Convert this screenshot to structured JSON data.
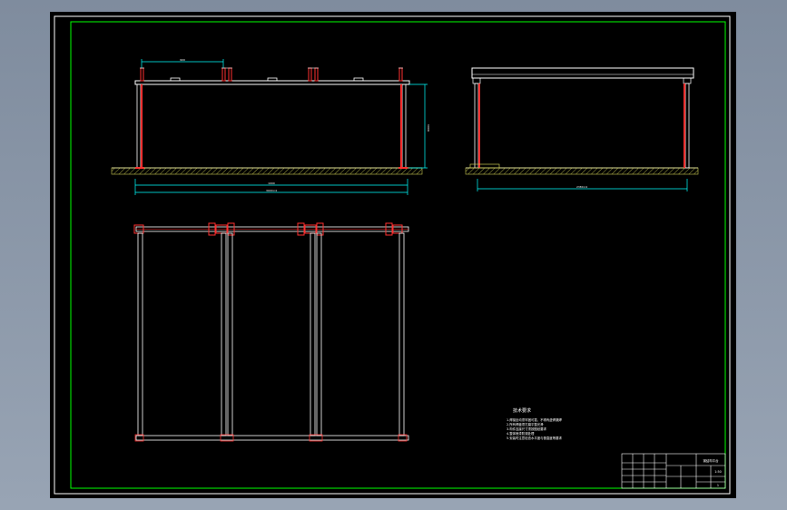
{
  "drawing": {
    "front_view": {
      "dim_top": "900",
      "dim_overall": "3000×4",
      "dim_span": "1000",
      "dim_height": "8004"
    },
    "side_view": {
      "dim_overall": "2380×4"
    },
    "notes": {
      "title": "技术要求",
      "lines": [
        "1.焊接处均须牢固可靠，不得有虚焊漏焊",
        "2.所有焊缝须打磨平整光滑",
        "3.构件连接尺寸须按图纸要求",
        "4.整体喷漆防锈处理",
        "5.安装时注意检查水平度与垂直度等要求"
      ]
    },
    "title_block": {
      "drawing_name": "钢结构平台",
      "scale": "1:50",
      "sheet": "1"
    }
  },
  "colors": {
    "frame": "#00ff00",
    "lines": "#ffffff",
    "accent": "#ff3030",
    "dimension": "#00ffff",
    "hatch": "#c8c850"
  }
}
